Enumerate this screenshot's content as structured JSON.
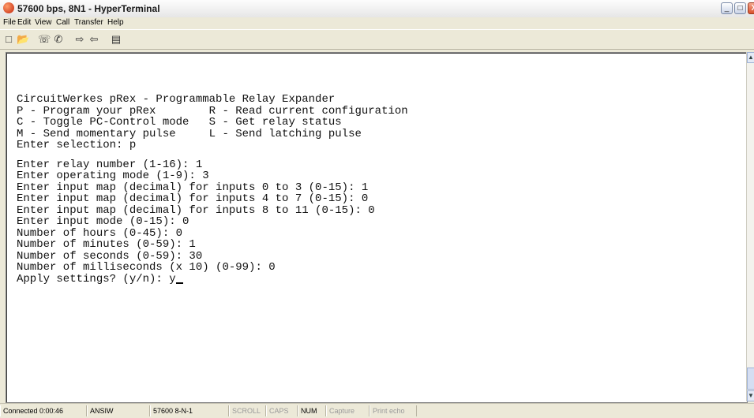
{
  "window": {
    "title": "57600 bps, 8N1 - HyperTerminal"
  },
  "window_controls": {
    "min": "_",
    "max": "□",
    "close": "X"
  },
  "menu": [
    "File",
    "Edit",
    "View",
    "Call",
    "Transfer",
    "Help"
  ],
  "toolbar_icons": [
    "new-icon",
    "open-icon",
    "disconnect-icon",
    "phone-icon",
    "send-icon",
    "receive-icon",
    "properties-icon"
  ],
  "terminal": {
    "header": [
      "CircuitWerkes pRex - Programmable Relay Expander",
      "P - Program your pRex        R - Read current configuration",
      "C - Toggle PC-Control mode   S - Get relay status",
      "M - Send momentary pulse     L - Send latching pulse",
      "Enter selection: p"
    ],
    "body": [
      "Enter relay number (1-16): 1",
      "Enter operating mode (1-9): 3",
      "Enter input map (decimal) for inputs 0 to 3 (0-15): 1",
      "Enter input map (decimal) for inputs 4 to 7 (0-15): 0",
      "Enter input map (decimal) for inputs 8 to 11 (0-15): 0",
      "Enter input mode (0-15): 0",
      "Number of hours (0-45): 0",
      "Number of minutes (0-59): 1",
      "Number of seconds (0-59): 30",
      "Number of milliseconds (x 10) (0-99): 0"
    ],
    "prompt": "Apply settings? (y/n): y"
  },
  "status": {
    "connected": "Connected 0:00:46",
    "emulation": "ANSIW",
    "settings": "57600 8-N-1",
    "scroll": "SCROLL",
    "caps": "CAPS",
    "num": "NUM",
    "capture": "Capture",
    "print_echo": "Print echo"
  }
}
